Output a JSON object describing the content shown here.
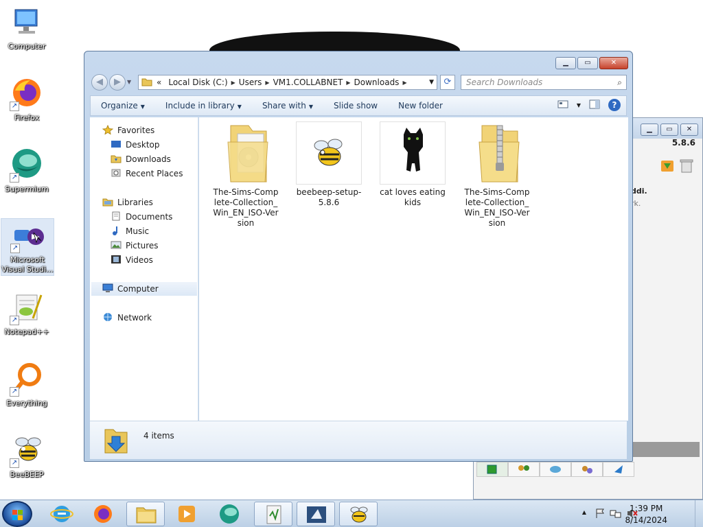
{
  "desktop": {
    "icons": [
      {
        "label": "Computer"
      },
      {
        "label": "Firefox"
      },
      {
        "label": "Supermium"
      },
      {
        "label": "Microsoft Visual Studi..."
      },
      {
        "label": "Notepad++"
      },
      {
        "label": "Everything"
      },
      {
        "label": "BeeBEEP"
      }
    ]
  },
  "beebeep_window": {
    "version": "5.8.6",
    "text_fragment_1": "ddi.",
    "text_fragment_2": "rk."
  },
  "explorer": {
    "address": {
      "overflow": "«",
      "segments": [
        "Local Disk (C:)",
        "Users",
        "VM1.COLLABNET",
        "Downloads"
      ]
    },
    "search_placeholder": "Search Downloads",
    "toolbar": {
      "organize": "Organize",
      "include_in_library": "Include in library",
      "share_with": "Share with",
      "slide_show": "Slide show",
      "new_folder": "New folder"
    },
    "nav": {
      "favorites": "Favorites",
      "desktop": "Desktop",
      "downloads": "Downloads",
      "recent_places": "Recent Places",
      "libraries": "Libraries",
      "documents": "Documents",
      "music": "Music",
      "pictures": "Pictures",
      "videos": "Videos",
      "computer": "Computer",
      "network": "Network"
    },
    "files": [
      {
        "name": "The-Sims-Complete-Collection_Win_EN_ISO-Version",
        "type": "folder-disc"
      },
      {
        "name": "beebeep-setup-5.8.6",
        "type": "installer"
      },
      {
        "name": "cat loves eating kids",
        "type": "image"
      },
      {
        "name": "The-Sims-Complete-Collection_Win_EN_ISO-Version",
        "type": "zip"
      }
    ],
    "status": "4 items"
  },
  "taskbar": {
    "time": "1:39 PM",
    "date": "8/14/2024"
  }
}
